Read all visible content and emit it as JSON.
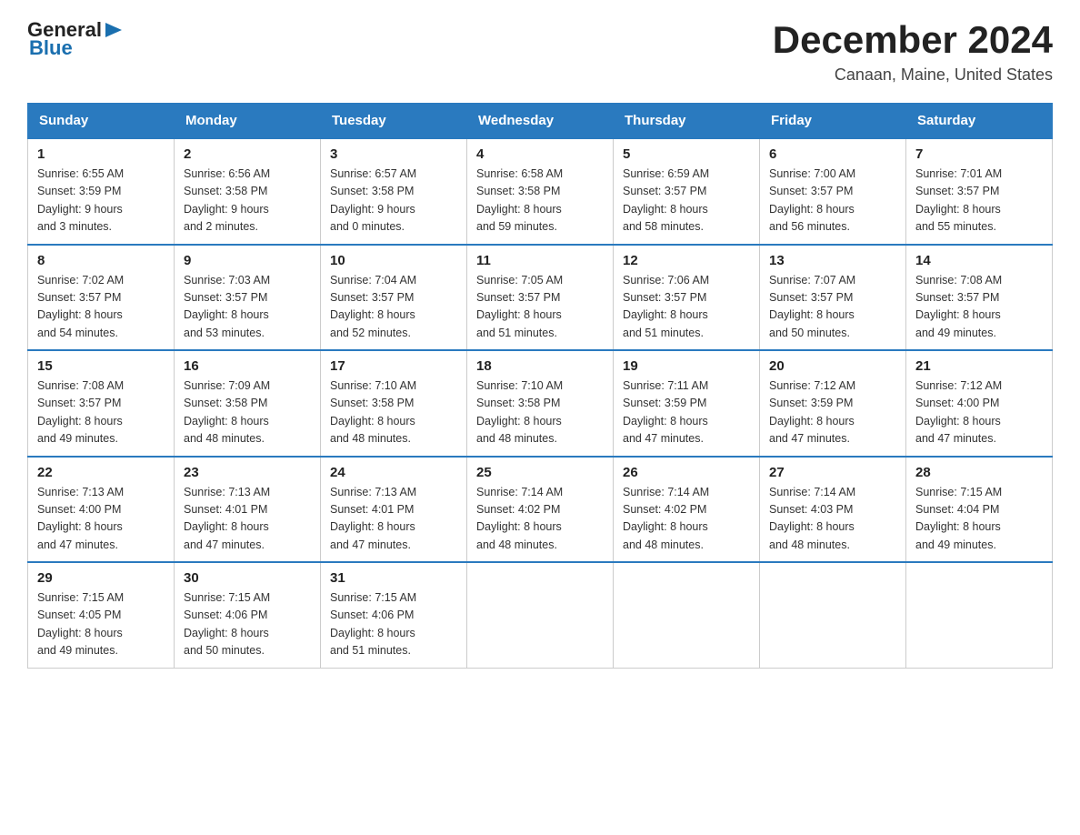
{
  "header": {
    "logo": {
      "general": "General",
      "blue": "Blue"
    },
    "title": "December 2024",
    "location": "Canaan, Maine, United States"
  },
  "columns": [
    "Sunday",
    "Monday",
    "Tuesday",
    "Wednesday",
    "Thursday",
    "Friday",
    "Saturday"
  ],
  "weeks": [
    [
      {
        "day": "1",
        "sunrise": "Sunrise: 6:55 AM",
        "sunset": "Sunset: 3:59 PM",
        "daylight": "Daylight: 9 hours",
        "daylight2": "and 3 minutes."
      },
      {
        "day": "2",
        "sunrise": "Sunrise: 6:56 AM",
        "sunset": "Sunset: 3:58 PM",
        "daylight": "Daylight: 9 hours",
        "daylight2": "and 2 minutes."
      },
      {
        "day": "3",
        "sunrise": "Sunrise: 6:57 AM",
        "sunset": "Sunset: 3:58 PM",
        "daylight": "Daylight: 9 hours",
        "daylight2": "and 0 minutes."
      },
      {
        "day": "4",
        "sunrise": "Sunrise: 6:58 AM",
        "sunset": "Sunset: 3:58 PM",
        "daylight": "Daylight: 8 hours",
        "daylight2": "and 59 minutes."
      },
      {
        "day": "5",
        "sunrise": "Sunrise: 6:59 AM",
        "sunset": "Sunset: 3:57 PM",
        "daylight": "Daylight: 8 hours",
        "daylight2": "and 58 minutes."
      },
      {
        "day": "6",
        "sunrise": "Sunrise: 7:00 AM",
        "sunset": "Sunset: 3:57 PM",
        "daylight": "Daylight: 8 hours",
        "daylight2": "and 56 minutes."
      },
      {
        "day": "7",
        "sunrise": "Sunrise: 7:01 AM",
        "sunset": "Sunset: 3:57 PM",
        "daylight": "Daylight: 8 hours",
        "daylight2": "and 55 minutes."
      }
    ],
    [
      {
        "day": "8",
        "sunrise": "Sunrise: 7:02 AM",
        "sunset": "Sunset: 3:57 PM",
        "daylight": "Daylight: 8 hours",
        "daylight2": "and 54 minutes."
      },
      {
        "day": "9",
        "sunrise": "Sunrise: 7:03 AM",
        "sunset": "Sunset: 3:57 PM",
        "daylight": "Daylight: 8 hours",
        "daylight2": "and 53 minutes."
      },
      {
        "day": "10",
        "sunrise": "Sunrise: 7:04 AM",
        "sunset": "Sunset: 3:57 PM",
        "daylight": "Daylight: 8 hours",
        "daylight2": "and 52 minutes."
      },
      {
        "day": "11",
        "sunrise": "Sunrise: 7:05 AM",
        "sunset": "Sunset: 3:57 PM",
        "daylight": "Daylight: 8 hours",
        "daylight2": "and 51 minutes."
      },
      {
        "day": "12",
        "sunrise": "Sunrise: 7:06 AM",
        "sunset": "Sunset: 3:57 PM",
        "daylight": "Daylight: 8 hours",
        "daylight2": "and 51 minutes."
      },
      {
        "day": "13",
        "sunrise": "Sunrise: 7:07 AM",
        "sunset": "Sunset: 3:57 PM",
        "daylight": "Daylight: 8 hours",
        "daylight2": "and 50 minutes."
      },
      {
        "day": "14",
        "sunrise": "Sunrise: 7:08 AM",
        "sunset": "Sunset: 3:57 PM",
        "daylight": "Daylight: 8 hours",
        "daylight2": "and 49 minutes."
      }
    ],
    [
      {
        "day": "15",
        "sunrise": "Sunrise: 7:08 AM",
        "sunset": "Sunset: 3:57 PM",
        "daylight": "Daylight: 8 hours",
        "daylight2": "and 49 minutes."
      },
      {
        "day": "16",
        "sunrise": "Sunrise: 7:09 AM",
        "sunset": "Sunset: 3:58 PM",
        "daylight": "Daylight: 8 hours",
        "daylight2": "and 48 minutes."
      },
      {
        "day": "17",
        "sunrise": "Sunrise: 7:10 AM",
        "sunset": "Sunset: 3:58 PM",
        "daylight": "Daylight: 8 hours",
        "daylight2": "and 48 minutes."
      },
      {
        "day": "18",
        "sunrise": "Sunrise: 7:10 AM",
        "sunset": "Sunset: 3:58 PM",
        "daylight": "Daylight: 8 hours",
        "daylight2": "and 48 minutes."
      },
      {
        "day": "19",
        "sunrise": "Sunrise: 7:11 AM",
        "sunset": "Sunset: 3:59 PM",
        "daylight": "Daylight: 8 hours",
        "daylight2": "and 47 minutes."
      },
      {
        "day": "20",
        "sunrise": "Sunrise: 7:12 AM",
        "sunset": "Sunset: 3:59 PM",
        "daylight": "Daylight: 8 hours",
        "daylight2": "and 47 minutes."
      },
      {
        "day": "21",
        "sunrise": "Sunrise: 7:12 AM",
        "sunset": "Sunset: 4:00 PM",
        "daylight": "Daylight: 8 hours",
        "daylight2": "and 47 minutes."
      }
    ],
    [
      {
        "day": "22",
        "sunrise": "Sunrise: 7:13 AM",
        "sunset": "Sunset: 4:00 PM",
        "daylight": "Daylight: 8 hours",
        "daylight2": "and 47 minutes."
      },
      {
        "day": "23",
        "sunrise": "Sunrise: 7:13 AM",
        "sunset": "Sunset: 4:01 PM",
        "daylight": "Daylight: 8 hours",
        "daylight2": "and 47 minutes."
      },
      {
        "day": "24",
        "sunrise": "Sunrise: 7:13 AM",
        "sunset": "Sunset: 4:01 PM",
        "daylight": "Daylight: 8 hours",
        "daylight2": "and 47 minutes."
      },
      {
        "day": "25",
        "sunrise": "Sunrise: 7:14 AM",
        "sunset": "Sunset: 4:02 PM",
        "daylight": "Daylight: 8 hours",
        "daylight2": "and 48 minutes."
      },
      {
        "day": "26",
        "sunrise": "Sunrise: 7:14 AM",
        "sunset": "Sunset: 4:02 PM",
        "daylight": "Daylight: 8 hours",
        "daylight2": "and 48 minutes."
      },
      {
        "day": "27",
        "sunrise": "Sunrise: 7:14 AM",
        "sunset": "Sunset: 4:03 PM",
        "daylight": "Daylight: 8 hours",
        "daylight2": "and 48 minutes."
      },
      {
        "day": "28",
        "sunrise": "Sunrise: 7:15 AM",
        "sunset": "Sunset: 4:04 PM",
        "daylight": "Daylight: 8 hours",
        "daylight2": "and 49 minutes."
      }
    ],
    [
      {
        "day": "29",
        "sunrise": "Sunrise: 7:15 AM",
        "sunset": "Sunset: 4:05 PM",
        "daylight": "Daylight: 8 hours",
        "daylight2": "and 49 minutes."
      },
      {
        "day": "30",
        "sunrise": "Sunrise: 7:15 AM",
        "sunset": "Sunset: 4:06 PM",
        "daylight": "Daylight: 8 hours",
        "daylight2": "and 50 minutes."
      },
      {
        "day": "31",
        "sunrise": "Sunrise: 7:15 AM",
        "sunset": "Sunset: 4:06 PM",
        "daylight": "Daylight: 8 hours",
        "daylight2": "and 51 minutes."
      },
      null,
      null,
      null,
      null
    ]
  ]
}
